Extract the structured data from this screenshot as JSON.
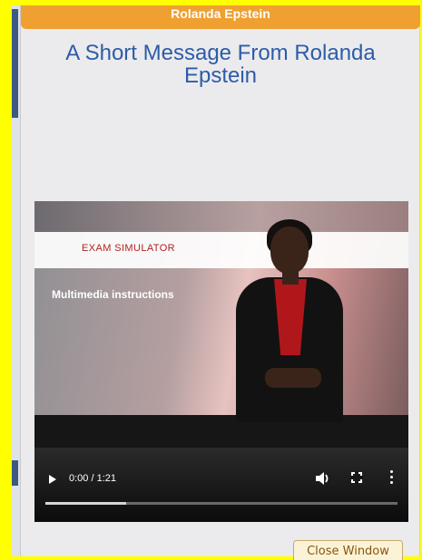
{
  "modal": {
    "header_label": "Rolanda Epstein",
    "title": "A Short Message From Rolanda Epstein",
    "close_button": "Close Window"
  },
  "video": {
    "banner_text": "EXAM SIMULATOR",
    "subtitle_text": "Multimedia instructions",
    "time_display": "0:00 / 1:21",
    "progress_buffered": 0.23,
    "controls": [
      "play-icon",
      "volume-icon",
      "fullscreen-icon",
      "more-options-icon"
    ]
  },
  "colors": {
    "header_bg": "#f0a030",
    "title_color": "#2d5ca8",
    "exam_text_color": "#b3211f",
    "frame_highlight": "#ffff00"
  }
}
